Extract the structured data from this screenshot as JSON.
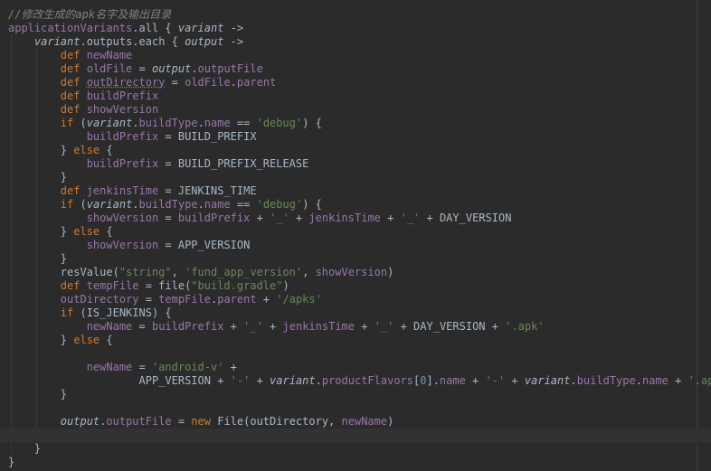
{
  "colors": {
    "background": "#2b2b2b",
    "comment": "#808080",
    "keyword": "#cc7832",
    "field": "#9876aa",
    "string": "#6a8759",
    "number": "#6897bb",
    "plain": "#a9b7c6"
  },
  "lines": [
    {
      "indent": "",
      "tokens": [
        {
          "t": "//修改生成的apk名字及输出目录",
          "c": "comment"
        }
      ]
    },
    {
      "indent": "",
      "tokens": [
        {
          "t": "applicationVariants",
          "c": "field"
        },
        {
          "t": ".all { "
        },
        {
          "t": "variant",
          "c": "param"
        },
        {
          "t": " ->"
        }
      ]
    },
    {
      "indent": "    ",
      "tokens": [
        {
          "t": "variant",
          "c": "param"
        },
        {
          "t": "."
        },
        {
          "t": "outputs",
          "c": "plain"
        },
        {
          "t": ".each { "
        },
        {
          "t": "output",
          "c": "param"
        },
        {
          "t": " ->"
        }
      ]
    },
    {
      "indent": "        ",
      "tokens": [
        {
          "t": "def ",
          "c": "keyword"
        },
        {
          "t": "newName",
          "c": "field"
        }
      ]
    },
    {
      "indent": "        ",
      "tokens": [
        {
          "t": "def ",
          "c": "keyword"
        },
        {
          "t": "oldFile",
          "c": "field"
        },
        {
          "t": " = "
        },
        {
          "t": "output",
          "c": "param"
        },
        {
          "t": "."
        },
        {
          "t": "outputFile",
          "c": "field"
        }
      ]
    },
    {
      "indent": "        ",
      "tokens": [
        {
          "t": "def ",
          "c": "keyword"
        },
        {
          "t": "outDirectory",
          "c": "unused"
        },
        {
          "t": " = "
        },
        {
          "t": "oldFile",
          "c": "field"
        },
        {
          "t": "."
        },
        {
          "t": "parent",
          "c": "field"
        }
      ]
    },
    {
      "indent": "        ",
      "tokens": [
        {
          "t": "def ",
          "c": "keyword"
        },
        {
          "t": "buildPrefix",
          "c": "field"
        }
      ]
    },
    {
      "indent": "        ",
      "tokens": [
        {
          "t": "def ",
          "c": "keyword"
        },
        {
          "t": "showVersion",
          "c": "field"
        }
      ]
    },
    {
      "indent": "        ",
      "tokens": [
        {
          "t": "if ",
          "c": "keyword"
        },
        {
          "t": "("
        },
        {
          "t": "variant",
          "c": "param"
        },
        {
          "t": "."
        },
        {
          "t": "buildType",
          "c": "field"
        },
        {
          "t": "."
        },
        {
          "t": "name",
          "c": "field"
        },
        {
          "t": " == "
        },
        {
          "t": "'debug'",
          "c": "string"
        },
        {
          "t": ") {"
        }
      ]
    },
    {
      "indent": "            ",
      "tokens": [
        {
          "t": "buildPrefix",
          "c": "field"
        },
        {
          "t": " = BUILD_PREFIX"
        }
      ]
    },
    {
      "indent": "        ",
      "tokens": [
        {
          "t": "} "
        },
        {
          "t": "else",
          "c": "keyword"
        },
        {
          "t": " {"
        }
      ]
    },
    {
      "indent": "            ",
      "tokens": [
        {
          "t": "buildPrefix",
          "c": "field"
        },
        {
          "t": " = BUILD_PREFIX_RELEASE"
        }
      ]
    },
    {
      "indent": "        ",
      "tokens": [
        {
          "t": "}"
        }
      ]
    },
    {
      "indent": "        ",
      "tokens": [
        {
          "t": "def ",
          "c": "keyword"
        },
        {
          "t": "jenkinsTime",
          "c": "field"
        },
        {
          "t": " = JENKINS_TIME"
        }
      ]
    },
    {
      "indent": "        ",
      "tokens": [
        {
          "t": "if ",
          "c": "keyword"
        },
        {
          "t": "("
        },
        {
          "t": "variant",
          "c": "param"
        },
        {
          "t": "."
        },
        {
          "t": "buildType",
          "c": "field"
        },
        {
          "t": "."
        },
        {
          "t": "name",
          "c": "field"
        },
        {
          "t": " == "
        },
        {
          "t": "'debug'",
          "c": "string"
        },
        {
          "t": ") {"
        }
      ]
    },
    {
      "indent": "            ",
      "tokens": [
        {
          "t": "showVersion",
          "c": "field"
        },
        {
          "t": " = "
        },
        {
          "t": "buildPrefix",
          "c": "field"
        },
        {
          "t": " + "
        },
        {
          "t": "'_'",
          "c": "string"
        },
        {
          "t": " + "
        },
        {
          "t": "jenkinsTime",
          "c": "field"
        },
        {
          "t": " + "
        },
        {
          "t": "'_'",
          "c": "string"
        },
        {
          "t": " + DAY_VERSION"
        }
      ]
    },
    {
      "indent": "        ",
      "tokens": [
        {
          "t": "} "
        },
        {
          "t": "else",
          "c": "keyword"
        },
        {
          "t": " {"
        }
      ]
    },
    {
      "indent": "            ",
      "tokens": [
        {
          "t": "showVersion",
          "c": "field"
        },
        {
          "t": " = APP_VERSION"
        }
      ]
    },
    {
      "indent": "        ",
      "tokens": [
        {
          "t": "}"
        }
      ]
    },
    {
      "indent": "        ",
      "tokens": [
        {
          "t": "resValue("
        },
        {
          "t": "\"string\"",
          "c": "string"
        },
        {
          "t": ", "
        },
        {
          "t": "'fund_app_version'",
          "c": "string"
        },
        {
          "t": ", "
        },
        {
          "t": "showVersion",
          "c": "field"
        },
        {
          "t": ")"
        }
      ]
    },
    {
      "indent": "        ",
      "tokens": [
        {
          "t": "def ",
          "c": "keyword"
        },
        {
          "t": "tempFile",
          "c": "field"
        },
        {
          "t": " = file("
        },
        {
          "t": "\"build.gradle\"",
          "c": "string"
        },
        {
          "t": ")"
        }
      ]
    },
    {
      "indent": "        ",
      "tokens": [
        {
          "t": "outDirectory",
          "c": "field"
        },
        {
          "t": " = "
        },
        {
          "t": "tempFile",
          "c": "field"
        },
        {
          "t": "."
        },
        {
          "t": "parent",
          "c": "field"
        },
        {
          "t": " + "
        },
        {
          "t": "'/apks'",
          "c": "string"
        }
      ]
    },
    {
      "indent": "        ",
      "tokens": [
        {
          "t": "if ",
          "c": "keyword"
        },
        {
          "t": "(IS_JENKINS) {"
        }
      ]
    },
    {
      "indent": "            ",
      "tokens": [
        {
          "t": "newName",
          "c": "field"
        },
        {
          "t": " = "
        },
        {
          "t": "buildPrefix",
          "c": "field"
        },
        {
          "t": " + "
        },
        {
          "t": "'_'",
          "c": "string"
        },
        {
          "t": " + "
        },
        {
          "t": "jenkinsTime",
          "c": "field"
        },
        {
          "t": " + "
        },
        {
          "t": "'_'",
          "c": "string"
        },
        {
          "t": " + DAY_VERSION + "
        },
        {
          "t": "'.apk'",
          "c": "string"
        }
      ]
    },
    {
      "indent": "        ",
      "tokens": [
        {
          "t": "} "
        },
        {
          "t": "else",
          "c": "keyword"
        },
        {
          "t": " {"
        }
      ]
    },
    {
      "indent": "",
      "tokens": []
    },
    {
      "indent": "            ",
      "tokens": [
        {
          "t": "newName",
          "c": "field"
        },
        {
          "t": " = "
        },
        {
          "t": "'android-v'",
          "c": "string"
        },
        {
          "t": " +"
        }
      ]
    },
    {
      "indent": "                    ",
      "tokens": [
        {
          "t": "APP_VERSION + "
        },
        {
          "t": "'-'",
          "c": "string"
        },
        {
          "t": " + "
        },
        {
          "t": "variant",
          "c": "param"
        },
        {
          "t": "."
        },
        {
          "t": "productFlavors",
          "c": "field"
        },
        {
          "t": "["
        },
        {
          "t": "0",
          "c": "number"
        },
        {
          "t": "]."
        },
        {
          "t": "name",
          "c": "field"
        },
        {
          "t": " + "
        },
        {
          "t": "'-'",
          "c": "string"
        },
        {
          "t": " + "
        },
        {
          "t": "variant",
          "c": "param"
        },
        {
          "t": "."
        },
        {
          "t": "buildType",
          "c": "field"
        },
        {
          "t": "."
        },
        {
          "t": "name",
          "c": "field"
        },
        {
          "t": " + "
        },
        {
          "t": "'.apk'",
          "c": "string"
        }
      ]
    },
    {
      "indent": "        ",
      "tokens": [
        {
          "t": "}"
        }
      ]
    },
    {
      "indent": "",
      "tokens": []
    },
    {
      "indent": "        ",
      "tokens": [
        {
          "t": "output",
          "c": "param"
        },
        {
          "t": "."
        },
        {
          "t": "outputFile",
          "c": "field"
        },
        {
          "t": " = "
        },
        {
          "t": "new ",
          "c": "keyword"
        },
        {
          "t": "File(outDirectory, "
        },
        {
          "t": "newName",
          "c": "field"
        },
        {
          "t": ")"
        }
      ]
    },
    {
      "indent": "",
      "tokens": [],
      "current": true
    },
    {
      "indent": "    ",
      "tokens": [
        {
          "t": "}"
        }
      ]
    },
    {
      "indent": "",
      "tokens": [
        {
          "t": "}"
        }
      ]
    }
  ]
}
